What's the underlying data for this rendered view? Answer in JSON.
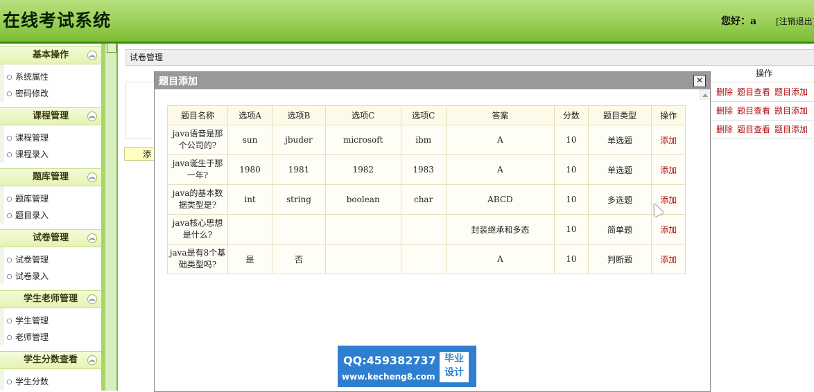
{
  "header": {
    "title": "在线考试系统",
    "greeting": "您好：a",
    "logout": "[注销退出]"
  },
  "sidebar": {
    "groups": [
      {
        "title": "基本操作",
        "items": [
          "系统属性",
          "密码修改"
        ]
      },
      {
        "title": "课程管理",
        "items": [
          "课程管理",
          "课程录入"
        ]
      },
      {
        "title": "题库管理",
        "items": [
          "题库管理",
          "题目录入"
        ]
      },
      {
        "title": "试卷管理",
        "items": [
          "试卷管理",
          "试卷录入"
        ]
      },
      {
        "title": "学生老师管理",
        "items": [
          "学生管理",
          "老师管理"
        ]
      },
      {
        "title": "学生分数查看",
        "items": [
          "学生分数"
        ]
      }
    ]
  },
  "main": {
    "panel_title": "试卷管理",
    "column_op": "操作",
    "row_actions": [
      "删除",
      "题目查看",
      "题目添加"
    ],
    "add_button": "添加"
  },
  "dialog": {
    "title": "题目添加",
    "close": "✕",
    "headers": [
      "题目名称",
      "选项A",
      "选项B",
      "选项C",
      "选项C",
      "答案",
      "分数",
      "题目类型",
      "操作"
    ],
    "rows": [
      [
        "java语音是那个公司的?",
        "sun",
        "jbuder",
        "microsoft",
        "ibm",
        "A",
        "10",
        "单选题",
        "添加"
      ],
      [
        "java诞生于那一年?",
        "1980",
        "1981",
        "1982",
        "1983",
        "A",
        "10",
        "单选题",
        "添加"
      ],
      [
        "java的基本数据类型是?",
        "int",
        "string",
        "boolean",
        "char",
        "ABCD",
        "10",
        "多选题",
        "添加"
      ],
      [
        "java核心思想是什么?",
        "",
        "",
        "",
        "",
        "封装继承和多态",
        "10",
        "简单题",
        "添加"
      ],
      [
        "java是有8个基础类型吗?",
        "是",
        "否",
        "",
        "",
        "A",
        "10",
        "判断题",
        "添加"
      ]
    ]
  },
  "watermark": {
    "qq": "QQ:459382737",
    "site": "www.kecheng8.com",
    "badge_line1": "毕业",
    "badge_line2": "设计"
  }
}
